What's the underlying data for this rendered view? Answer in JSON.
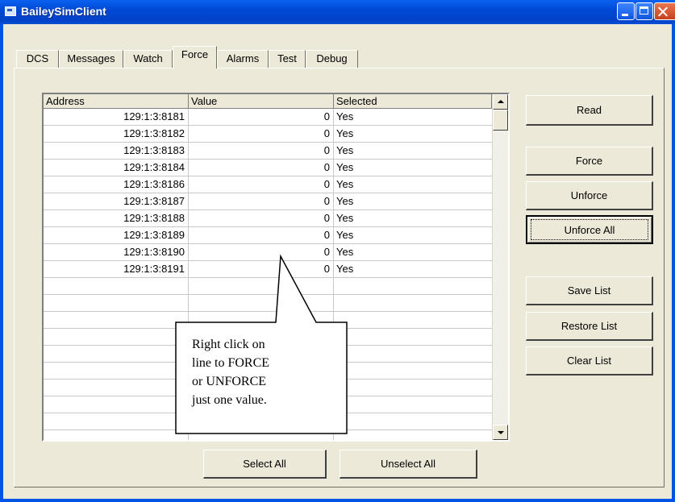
{
  "window": {
    "title": "BaileySimClient"
  },
  "tabs": [
    {
      "label": "DCS"
    },
    {
      "label": "Messages"
    },
    {
      "label": "Watch"
    },
    {
      "label": "Force"
    },
    {
      "label": "Alarms"
    },
    {
      "label": "Test"
    },
    {
      "label": "Debug"
    }
  ],
  "active_tab": "Force",
  "list": {
    "columns": {
      "address": "Address",
      "value": "Value",
      "selected": "Selected"
    },
    "rows": [
      {
        "address": "129:1:3:8181",
        "value": "0",
        "selected": "Yes"
      },
      {
        "address": "129:1:3:8182",
        "value": "0",
        "selected": "Yes"
      },
      {
        "address": "129:1:3:8183",
        "value": "0",
        "selected": "Yes"
      },
      {
        "address": "129:1:3:8184",
        "value": "0",
        "selected": "Yes"
      },
      {
        "address": "129:1:3:8186",
        "value": "0",
        "selected": "Yes"
      },
      {
        "address": "129:1:3:8187",
        "value": "0",
        "selected": "Yes"
      },
      {
        "address": "129:1:3:8188",
        "value": "0",
        "selected": "Yes"
      },
      {
        "address": "129:1:3:8189",
        "value": "0",
        "selected": "Yes"
      },
      {
        "address": "129:1:3:8190",
        "value": "0",
        "selected": "Yes"
      },
      {
        "address": "129:1:3:8191",
        "value": "0",
        "selected": "Yes"
      }
    ]
  },
  "buttons": {
    "read": "Read",
    "force": "Force",
    "unforce": "Unforce",
    "unforce_all": "Unforce All",
    "save_list": "Save List",
    "restore_list": "Restore List",
    "clear_list": "Clear List",
    "select_all": "Select All",
    "unselect_all": "Unselect All"
  },
  "callout": {
    "text": "Right click on\nline to FORCE\nor UNFORCE\njust one value."
  },
  "icons": {
    "app": "app-window-icon",
    "minimize": "minimize-icon",
    "maximize": "maximize-icon",
    "close": "close-icon"
  },
  "colors": {
    "titlebar": "#0054e3",
    "face": "#ece9d8",
    "close": "#c8401c"
  }
}
